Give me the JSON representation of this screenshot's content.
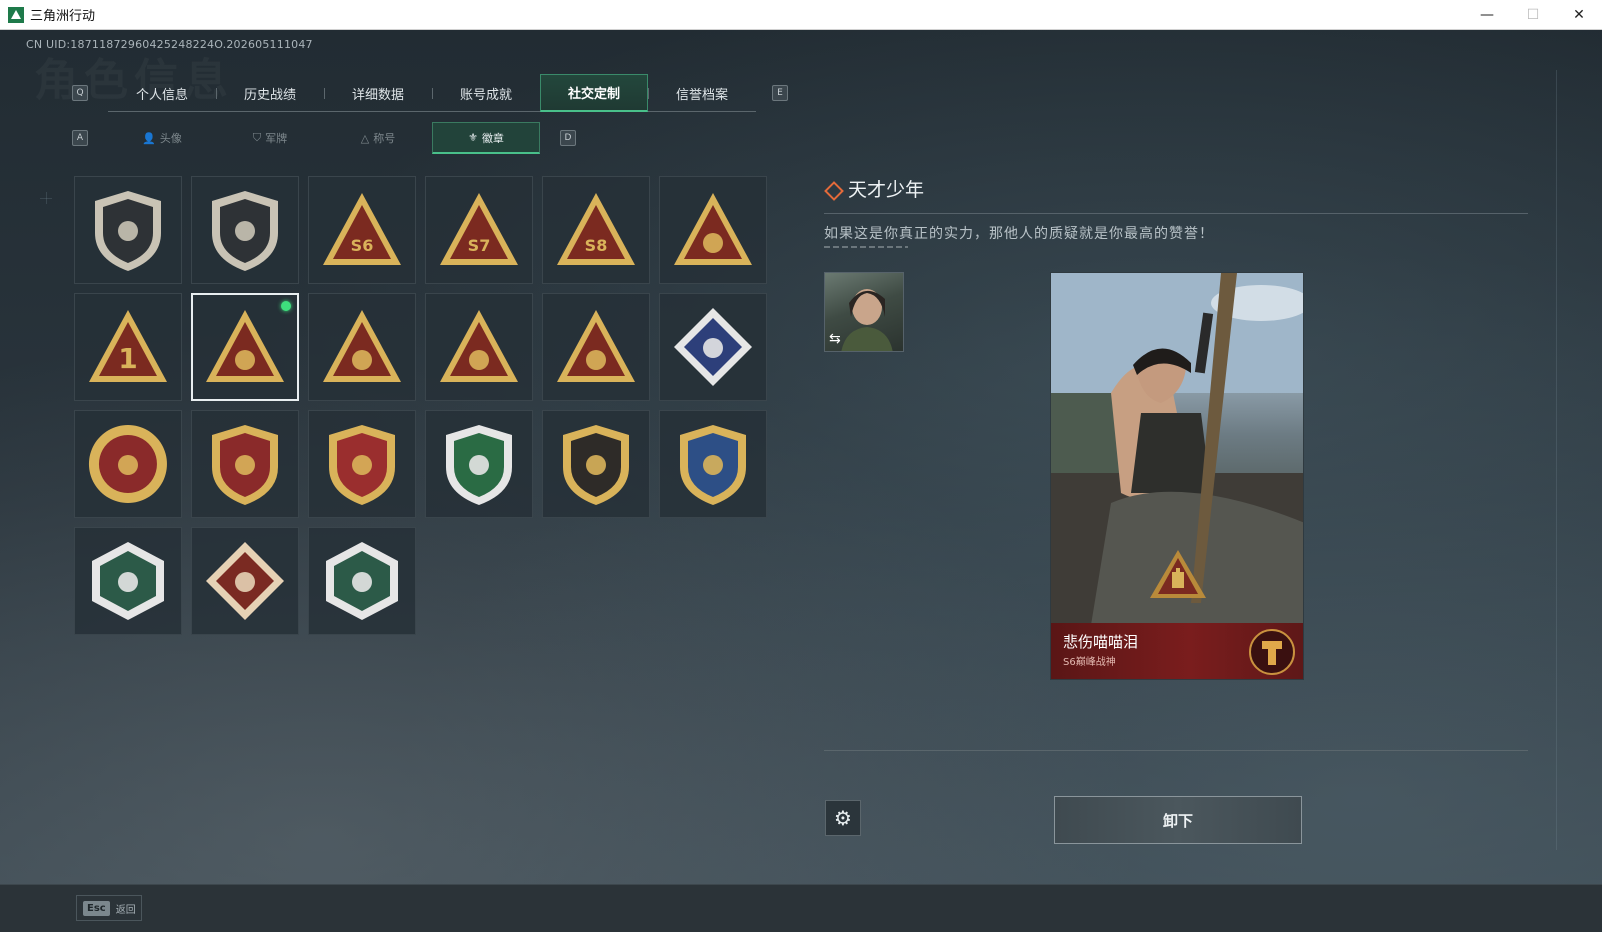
{
  "window": {
    "title": "三角洲行动",
    "controls": {
      "minimize": "—",
      "maximize": "☐",
      "close": "✕"
    }
  },
  "header": {
    "uid": "CN UID:18711872960425248224O.202605111047",
    "watermark": "角色信息"
  },
  "main_tabs": {
    "left_key": "Q",
    "right_key": "E",
    "items": [
      {
        "label": "个人信息",
        "active": false
      },
      {
        "label": "历史战绩",
        "active": false
      },
      {
        "label": "详细数据",
        "active": false
      },
      {
        "label": "账号成就",
        "active": false
      },
      {
        "label": "社交定制",
        "active": true
      },
      {
        "label": "信誉档案",
        "active": false
      }
    ]
  },
  "sub_tabs": {
    "left_key": "A",
    "right_key": "D",
    "items": [
      {
        "label": "头像",
        "icon": "person-icon",
        "active": false
      },
      {
        "label": "军牌",
        "icon": "shield-icon",
        "active": false
      },
      {
        "label": "称号",
        "icon": "triangle-icon",
        "active": false
      },
      {
        "label": "徽章",
        "icon": "wings-icon",
        "active": true
      }
    ]
  },
  "badges": [
    {
      "icon": "shield-delta-badge-icon",
      "shape": "shield",
      "fg": "#c9c3b5",
      "bg": "#2e3236",
      "selected": false
    },
    {
      "icon": "helicopter-badge-icon",
      "shape": "shield",
      "fg": "#c9c3b5",
      "bg": "#2e3236",
      "selected": false
    },
    {
      "icon": "s6-triangle-badge-icon",
      "shape": "triangle",
      "text": "S6",
      "fg": "#d9b35a",
      "bg": "#7b2a20",
      "selected": false
    },
    {
      "icon": "s7-triangle-badge-icon",
      "shape": "triangle",
      "text": "S7",
      "fg": "#d9b35a",
      "bg": "#7b2a20",
      "selected": false
    },
    {
      "icon": "s8-triangle-badge-icon",
      "shape": "triangle",
      "text": "S8",
      "fg": "#d9b35a",
      "bg": "#7b2a20",
      "selected": false
    },
    {
      "icon": "nest-triangle-badge-icon",
      "shape": "triangle",
      "fg": "#d9b35a",
      "bg": "#7b2a20",
      "selected": false
    },
    {
      "icon": "number-one-triangle-badge-icon",
      "shape": "triangle",
      "text": "1",
      "fg": "#d9b35a",
      "bg": "#7b2a20",
      "selected": false
    },
    {
      "icon": "genius-triangle-badge-icon",
      "shape": "triangle",
      "fg": "#d9b35a",
      "bg": "#7b2a20",
      "selected": true,
      "equipped": true
    },
    {
      "icon": "hands-dice-triangle-badge-icon",
      "shape": "triangle",
      "fg": "#d9b35a",
      "bg": "#7b2a20",
      "selected": false
    },
    {
      "icon": "squad-triangle-badge-icon",
      "shape": "triangle",
      "fg": "#d9b35a",
      "bg": "#7b2a20",
      "selected": false
    },
    {
      "icon": "rocket-triangle-badge-icon",
      "shape": "triangle",
      "fg": "#d9b35a",
      "bg": "#7b2a20",
      "selected": false
    },
    {
      "icon": "rose-diamond-badge-icon",
      "shape": "diamond",
      "fg": "#e6e6e6",
      "bg": "#2d3f7a",
      "selected": false
    },
    {
      "icon": "star-medal-badge-icon",
      "shape": "circle",
      "fg": "#d9b35a",
      "bg": "#8a2a2a",
      "selected": false
    },
    {
      "icon": "three-star-shield-badge-icon",
      "shape": "shield",
      "fg": "#d9b35a",
      "bg": "#8a2a2a",
      "selected": false
    },
    {
      "icon": "three-star-hex-badge-icon",
      "shape": "shield",
      "fg": "#d9b35a",
      "bg": "#9a2e2e",
      "selected": false
    },
    {
      "icon": "green-rifle-shield-badge-icon",
      "shape": "shield",
      "fg": "#e6e6e6",
      "bg": "#2a6b44",
      "selected": false
    },
    {
      "icon": "dark-rifle-shield-badge-icon",
      "shape": "shield",
      "fg": "#d9b35a",
      "bg": "#2e2b28",
      "selected": false
    },
    {
      "icon": "blue-crosshair-shield-badge-icon",
      "shape": "shield",
      "fg": "#d9b35a",
      "bg": "#2d4f86",
      "selected": false
    },
    {
      "icon": "wasp-hex-badge-icon",
      "shape": "hexagon",
      "fg": "#e6e6e6",
      "bg": "#2c5a48",
      "selected": false
    },
    {
      "icon": "dragon-diamond-badge-icon",
      "shape": "diamond",
      "fg": "#e6d2b5",
      "bg": "#7a2a22",
      "selected": false
    },
    {
      "icon": "dragonfly-hex-badge-icon",
      "shape": "hexagon",
      "fg": "#e6e6e6",
      "bg": "#2c5a48",
      "selected": false
    }
  ],
  "detail": {
    "title": "天才少年",
    "description": "如果这是你真正的实力，那他人的质疑就是你最高的赞誉！",
    "avatar_icon": "character-avatar-icon",
    "swap_icon": "⇆"
  },
  "card": {
    "player_name": "悲伤喵喵泪",
    "rank_text": "S6巅峰战神"
  },
  "actions": {
    "settings_icon": "⚙",
    "unequip_label": "卸下"
  },
  "footer": {
    "esc_key": "Esc",
    "esc_label": "返回"
  },
  "colors": {
    "accent_green": "#49c08a",
    "equipped_dot": "#3ee07d",
    "card_red": "#7a1d1d",
    "title_diamond": "#e46a3a"
  }
}
